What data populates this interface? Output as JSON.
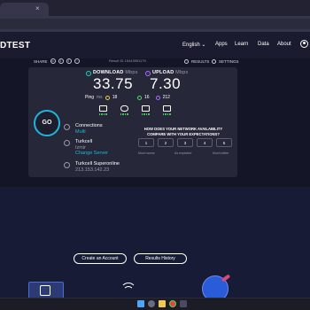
{
  "site": {
    "logo": "DTEST",
    "nav": {
      "language": "English ⌄",
      "apps": "Apps",
      "learn": "Learn",
      "data": "Data",
      "about": "About"
    }
  },
  "toolbar": {
    "share_label": "SHARE",
    "share_icons": [
      "link-icon",
      "twitter-icon",
      "facebook-icon",
      "more-icon"
    ],
    "results_label": "RESULTS",
    "settings_label": "SETTINGS"
  },
  "result": {
    "id_label": "Result ID 15443951179"
  },
  "download": {
    "label": "DOWNLOAD",
    "unit": "Mbps",
    "value": "33.75",
    "icon": "download-arrow-icon",
    "color": "#19d3c5"
  },
  "upload": {
    "label": "UPLOAD",
    "unit": "Mbps",
    "value": "7.30",
    "icon": "upload-arrow-icon",
    "color": "#b06cff"
  },
  "ping": {
    "label": "Ping",
    "unit": "ms",
    "value": "18",
    "download_latency": "16",
    "upload_latency": "212"
  },
  "activities": [
    "video-chat-icon",
    "gaming-icon",
    "streaming-icon",
    "video-call-icon"
  ],
  "go_button": {
    "label": "GO",
    "accent": "#1fb6d8"
  },
  "connections": {
    "title": "Connections",
    "value": "Multi"
  },
  "provider": {
    "name": "Turkcell",
    "location": "Izmir",
    "change_label": "Change Server"
  },
  "server": {
    "name": "Turkcell Superonline",
    "ip": "213.153.142.23"
  },
  "survey": {
    "question": "HOW DOES YOUR NETWORK AVAILABILITY COMPARE WITH YOUR EXPECTATIONS?",
    "options": [
      "1",
      "2",
      "3",
      "4",
      "5"
    ],
    "low_label": "Much worse",
    "mid_label": "As expected",
    "high_label": "Much better"
  },
  "actions": {
    "create_account": "Create an Account",
    "results_history": "Results History"
  },
  "taskbar": {
    "icons": [
      "start-icon",
      "search-icon",
      "folder-icon",
      "chrome-icon",
      "app-icon"
    ]
  }
}
